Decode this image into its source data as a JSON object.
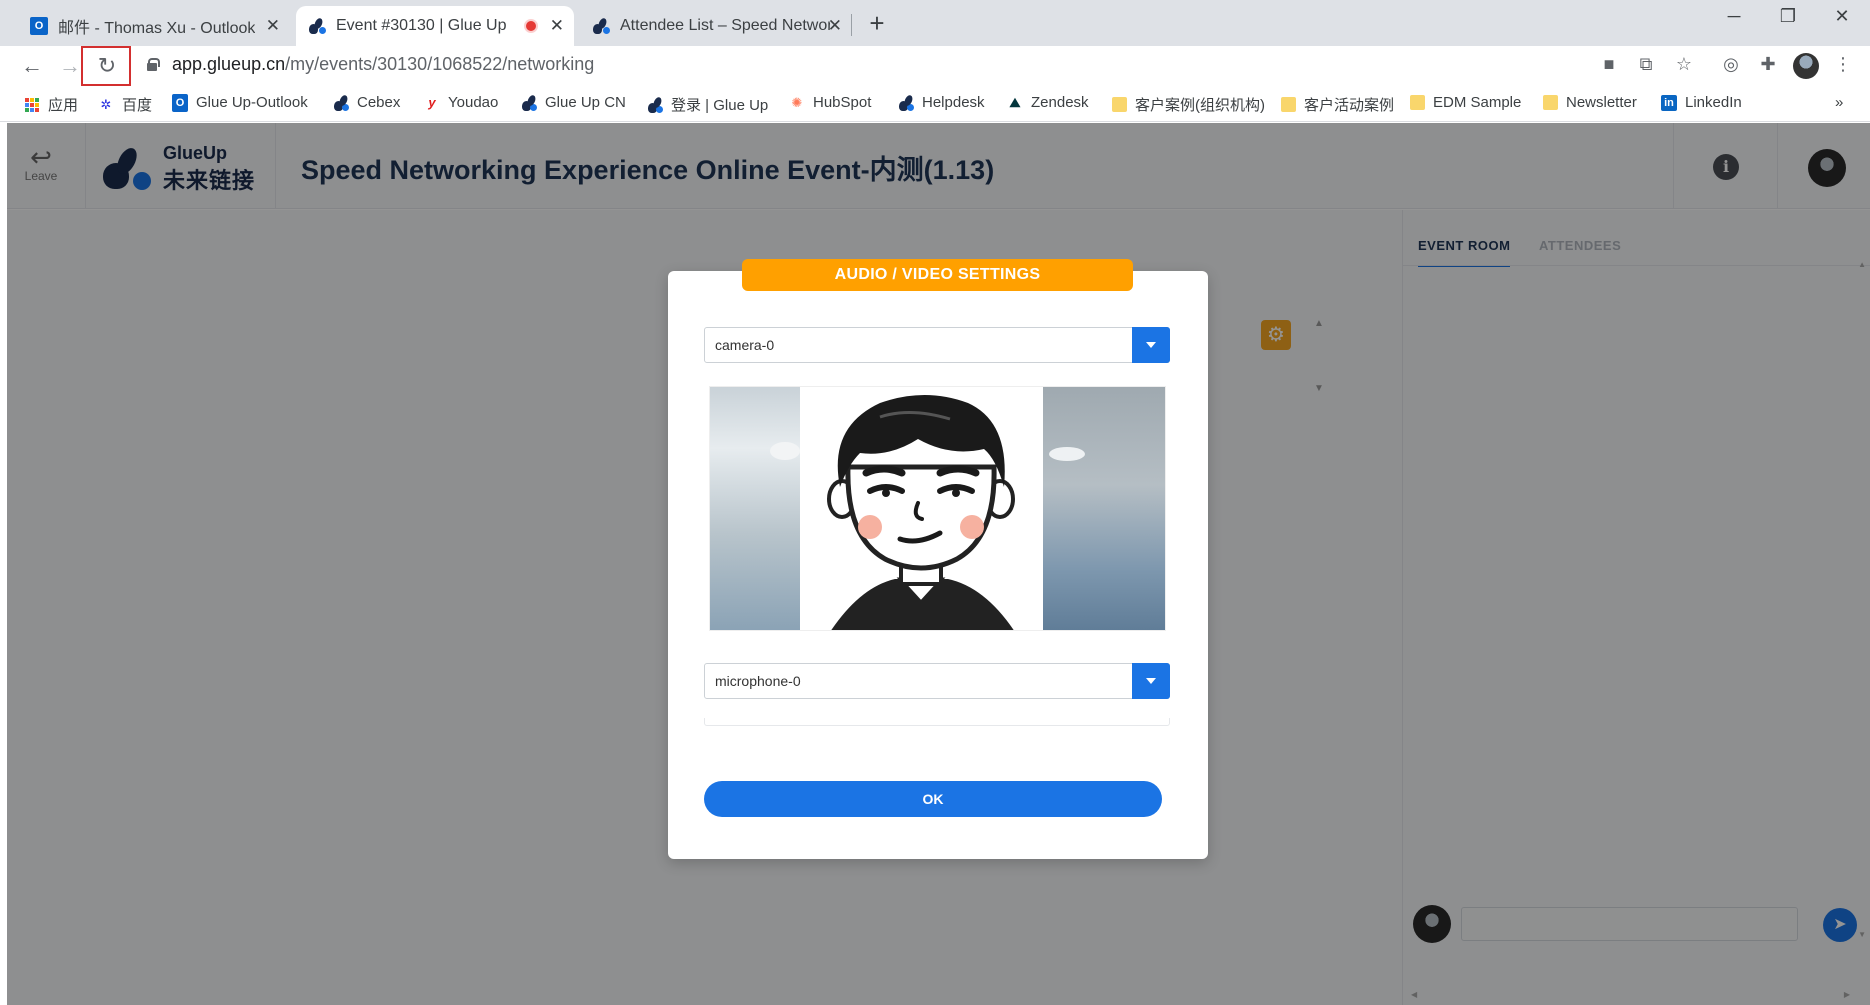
{
  "browser": {
    "tabs": [
      {
        "title": "邮件 - Thomas Xu - Outlook",
        "icon": "outlook-icon",
        "active": false
      },
      {
        "title": "Event #30130 | Glue Up",
        "icon": "glueup-icon",
        "active": true,
        "recording": true
      },
      {
        "title": "Attendee List – Speed Networ",
        "icon": "glueup-icon",
        "active": false
      }
    ],
    "url_host": "app.glueup.cn",
    "url_path": "/my/events/30130/1068522/networking",
    "bookmarks": [
      {
        "label": "应用",
        "icon": "apps-icon"
      },
      {
        "label": "百度",
        "icon": "baidu-icon"
      },
      {
        "label": "Glue Up-Outlook",
        "icon": "outlook-icon"
      },
      {
        "label": "Cebex",
        "icon": "glueup-icon"
      },
      {
        "label": "Youdao",
        "icon": "youdao-icon"
      },
      {
        "label": "Glue Up CN",
        "icon": "glueup-icon"
      },
      {
        "label": "登录 | Glue Up",
        "icon": "glueup-icon"
      },
      {
        "label": "HubSpot",
        "icon": "hubspot-icon"
      },
      {
        "label": "Helpdesk",
        "icon": "glueup-icon"
      },
      {
        "label": "Zendesk",
        "icon": "zendesk-icon"
      },
      {
        "label": "客户案例(组织机构)",
        "icon": "folder-icon"
      },
      {
        "label": "客户活动案例",
        "icon": "folder-icon"
      },
      {
        "label": "EDM Sample",
        "icon": "folder-icon"
      },
      {
        "label": "Newsletter",
        "icon": "folder-icon"
      },
      {
        "label": "LinkedIn",
        "icon": "linkedin-icon"
      }
    ],
    "bookmarks_overflow": "»"
  },
  "app": {
    "leave_label": "Leave",
    "logo_en": "GlueUp",
    "logo_cn": "未来链接",
    "event_title": "Speed Networking Experience Online Event-内测(1.13)",
    "side_tabs": [
      "EVENT ROOM",
      "ATTENDEES"
    ],
    "chat_placeholder": ""
  },
  "modal": {
    "title": "AUDIO / VIDEO SETTINGS",
    "camera_value": "camera-0",
    "microphone_value": "microphone-0",
    "ok_label": "OK"
  },
  "colors": {
    "accent": "#1b74e4",
    "modal_title_bg": "#ffa000",
    "highlight_box": "#d32f2f"
  }
}
